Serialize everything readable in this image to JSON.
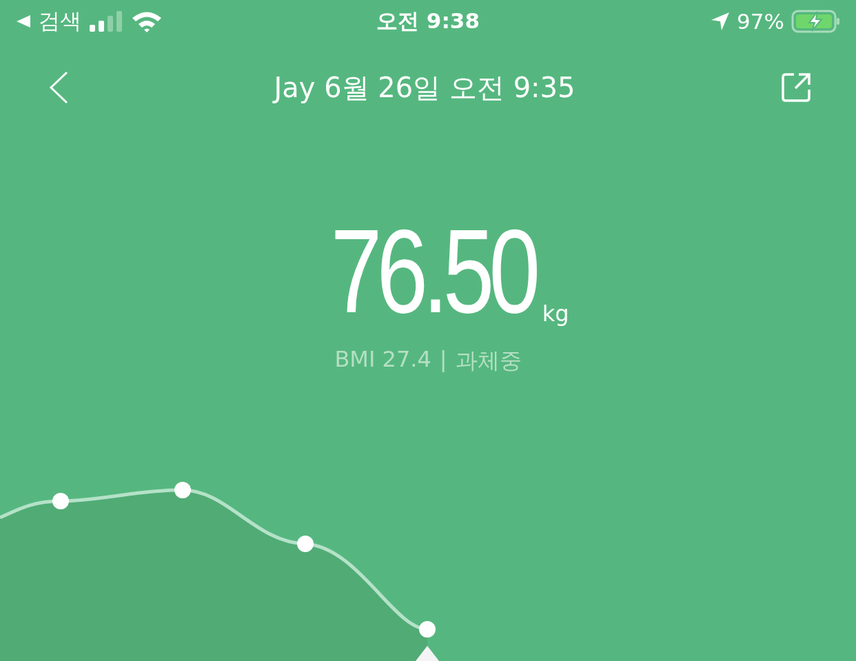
{
  "status_bar": {
    "back_app": "검색",
    "time": "오전 9:38",
    "battery": "97%"
  },
  "header": {
    "title": "Jay 6월 26일 오전 9:35"
  },
  "weight": {
    "value": "76.50",
    "unit": "kg",
    "bmi": "BMI 27.4",
    "separator": "|",
    "category": "과체중"
  }
}
